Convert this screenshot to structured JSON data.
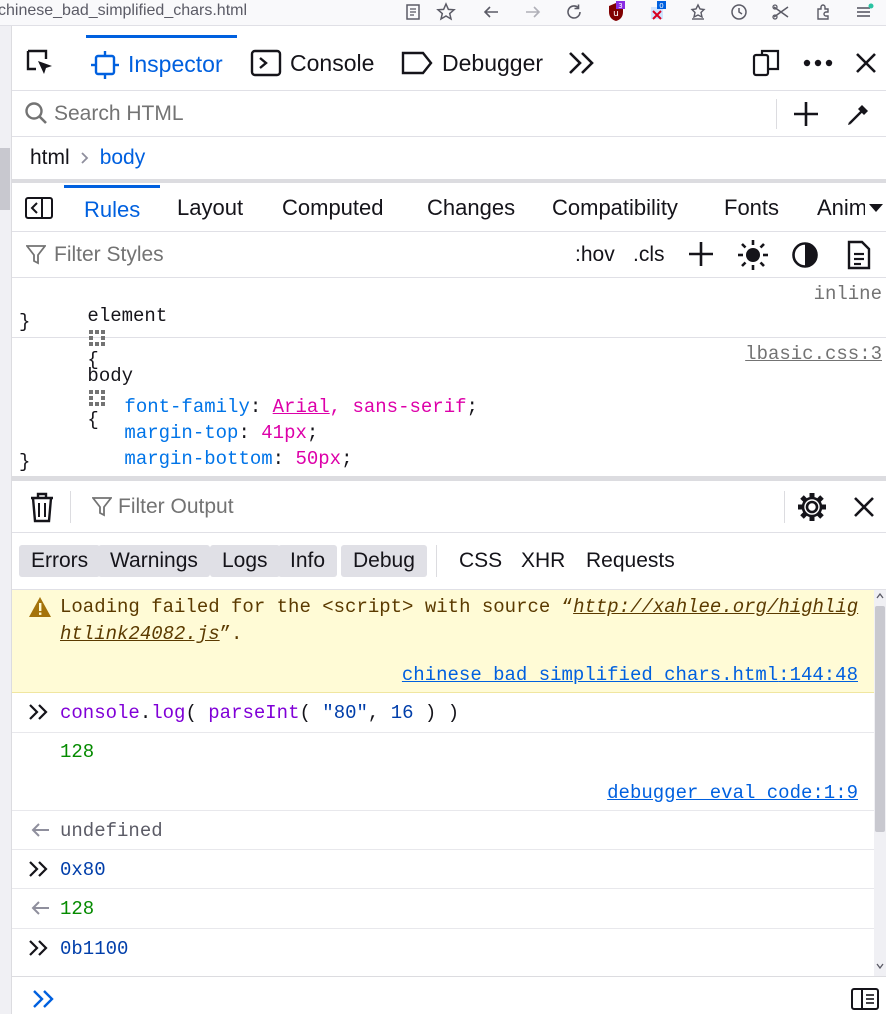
{
  "browser": {
    "url": "chinese_bad_simplified_chars.html",
    "badge_ublock": "3",
    "badge_ext": "0"
  },
  "devtools_tabs": [
    {
      "label": "Inspector",
      "icon": "inspector-icon",
      "active": true
    },
    {
      "label": "Console",
      "icon": "console-icon",
      "active": false
    },
    {
      "label": "Debugger",
      "icon": "debugger-icon",
      "active": false
    }
  ],
  "inspector": {
    "search_placeholder": "Search HTML",
    "breadcrumb": [
      "html",
      "body"
    ]
  },
  "rules_tabs": [
    "Rules",
    "Layout",
    "Computed",
    "Changes",
    "Compatibility",
    "Fonts",
    "Anim"
  ],
  "styles": {
    "filter_placeholder": "Filter Styles",
    "hov": ":hov",
    "cls": ".cls",
    "element_rule": {
      "selector": "element",
      "open": "{",
      "close": "}",
      "source": "inline"
    },
    "body_rule": {
      "selector": "body",
      "open": "{",
      "close": "}",
      "source": "lbasic.css:3",
      "declarations": [
        {
          "prop": "font-family",
          "val": "Arial, sans-serif",
          "val_link": "Arial",
          "val_rest": ", sans-serif"
        },
        {
          "prop": "margin-top",
          "val": "41px"
        },
        {
          "prop": "margin-bottom",
          "val": "50px"
        }
      ]
    }
  },
  "console": {
    "filter_placeholder": "Filter Output",
    "filters": [
      "Errors",
      "Warnings",
      "Logs",
      "Info",
      "Debug",
      "CSS",
      "XHR",
      "Requests"
    ],
    "warning": {
      "prefix": "Loading failed for the <script> with source “",
      "url_line1": "http://xahlee.org/highlig",
      "url_line2": "htlink24082.js",
      "suffix": "”.",
      "location_file": "chinese_bad_simplified_chars.html",
      "location_pos": ":144:48"
    },
    "log_input": {
      "fn1": "console",
      "dot": ".",
      "fn2": "log",
      "open": "( ",
      "fn3": "parseInt",
      "open2": "( ",
      "str": "\"80\"",
      "comma": ", ",
      "num": "16",
      "close": " ) )"
    },
    "log_output": "128",
    "log_location": "debugger eval code:1:9",
    "result_undefined": "undefined",
    "hex_input": "0x80",
    "hex_result": "128",
    "bin_input": "0b1100"
  }
}
